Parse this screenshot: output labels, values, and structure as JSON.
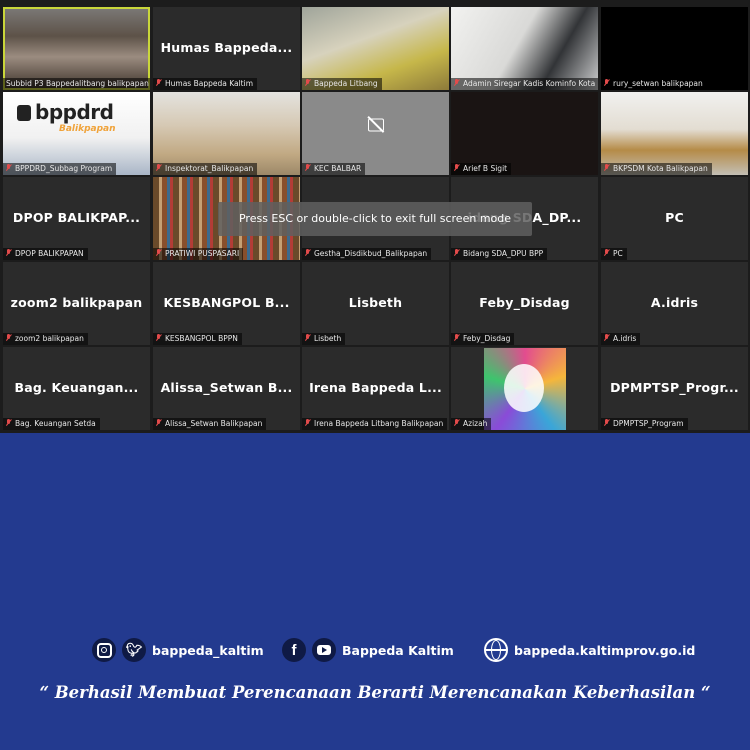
{
  "tiles": [
    {
      "id": "t1",
      "name": "Subbid P3 Bappedalitbang balikpapan",
      "display": "",
      "style": "v-room",
      "active": true
    },
    {
      "id": "t2",
      "name": "Humas Bappeda Kaltim",
      "display": "Humas  Bappeda...",
      "style": ""
    },
    {
      "id": "t3",
      "name": "Bappeda Litbang",
      "display": "",
      "style": "v-litbang"
    },
    {
      "id": "t4",
      "name": "Adamin Siregar Kadis Kominfo Kota Bali...",
      "display": "",
      "style": "v-kadis"
    },
    {
      "id": "t5",
      "name": "rury_setwan balikpapan",
      "display": "",
      "style": "v-black"
    },
    {
      "id": "t6",
      "name": "BPPDRD_Subbag Program",
      "display": "",
      "style": "v-bppdrd"
    },
    {
      "id": "t7",
      "name": "Inspektorat_Balikpapan",
      "display": "",
      "style": "v-inspektorat"
    },
    {
      "id": "t8",
      "name": "KEC BALBAR",
      "display": "",
      "style": "v-gray"
    },
    {
      "id": "t9",
      "name": "Arief B Sigit",
      "display": "",
      "style": "v-dark"
    },
    {
      "id": "t10",
      "name": "BKPSDM Kota Balikpapan",
      "display": "",
      "style": "v-bkpsdm"
    },
    {
      "id": "t11",
      "name": "DPOP BALIKPAPAN",
      "display": "DPOP  BALIKPAP...",
      "style": ""
    },
    {
      "id": "t12",
      "name": "PRATIWI PUSPASARI",
      "display": "",
      "style": "v-library"
    },
    {
      "id": "t13",
      "name": "Gestha_Disdikbud_Balikpapan",
      "display": "",
      "style": ""
    },
    {
      "id": "t14",
      "name": "Bidang SDA_DPU BPP",
      "display": "idang  SDA_DP...",
      "style": ""
    },
    {
      "id": "t15",
      "name": "PC",
      "display": "PC",
      "style": ""
    },
    {
      "id": "t16",
      "name": "zoom2 balikpapan",
      "display": "zoom2 balikpapan",
      "style": ""
    },
    {
      "id": "t17",
      "name": "KESBANGPOL BPPN",
      "display": "KESBANGPOL  B...",
      "style": ""
    },
    {
      "id": "t18",
      "name": "Lisbeth",
      "display": "Lisbeth",
      "style": ""
    },
    {
      "id": "t19",
      "name": "Feby_Disdag",
      "display": "Feby_Disdag",
      "style": ""
    },
    {
      "id": "t20",
      "name": "A.idris",
      "display": "A.idris",
      "style": ""
    },
    {
      "id": "t21",
      "name": "Bag. Keuangan Setda",
      "display": "Bag.  Keuangan...",
      "style": ""
    },
    {
      "id": "t22",
      "name": "Alissa_Setwan Balikpapan",
      "display": "Alissa_Setwan  B...",
      "style": ""
    },
    {
      "id": "t23",
      "name": "Irena Bappeda Litbang Balikpapan",
      "display": "Irena  Bappeda  L...",
      "style": ""
    },
    {
      "id": "t24",
      "name": "Azizah",
      "display": "",
      "style": "v-avatar"
    },
    {
      "id": "t25",
      "name": "DPMPTSP_Program",
      "display": "DPMPTSP_Progr...",
      "style": ""
    }
  ],
  "bppdrd_logo": "bppdrd",
  "bppdrd_sub": "Balikpapan",
  "esc_banner": "Press ESC or double-click to exit full screen mode",
  "footer": {
    "instagram_twitter_handle": "bappeda_kaltim",
    "facebook_youtube_name": "Bappeda Kaltim",
    "website": "bappeda.kaltimprov.go.id",
    "icons": [
      "instagram-icon",
      "twitter-icon",
      "facebook-icon",
      "youtube-icon",
      "globe-icon"
    ]
  },
  "tagline": "“ Berhasil  Membuat Perencanaan Berarti Merencanakan Keberhasilan “"
}
